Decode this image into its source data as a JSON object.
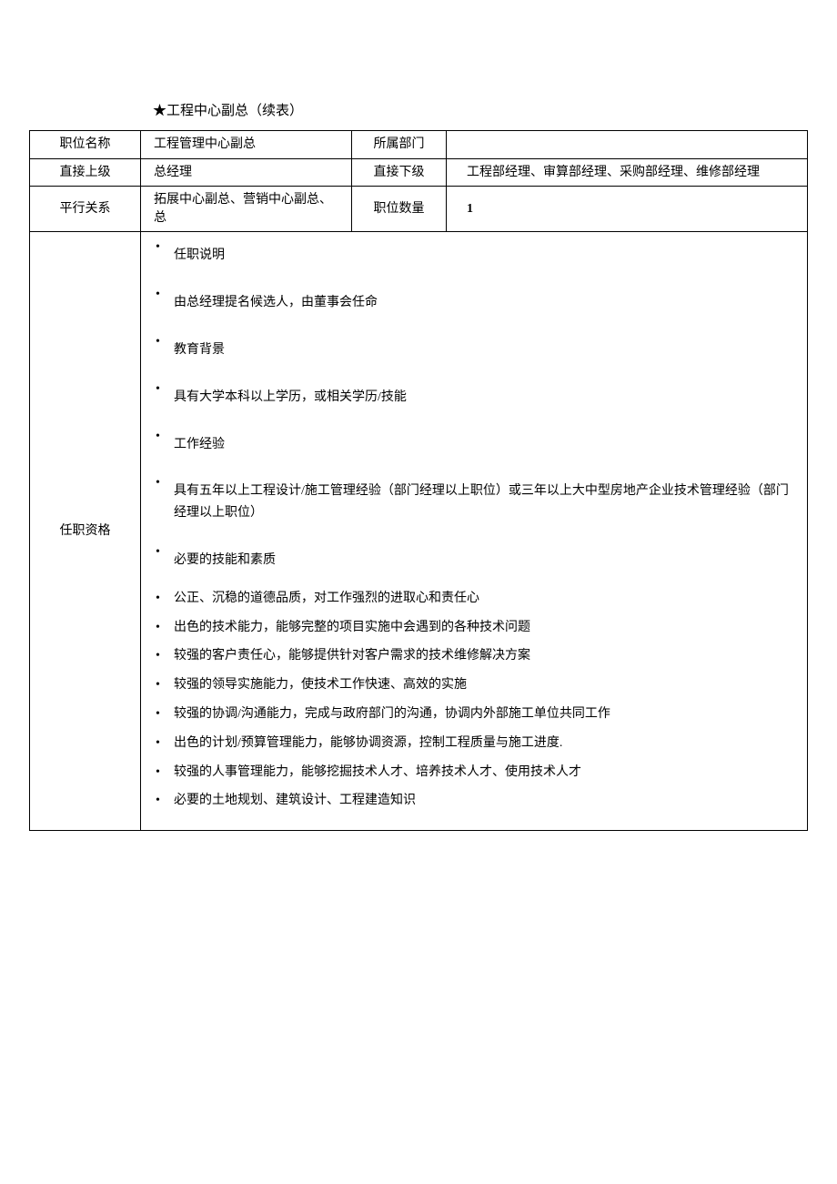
{
  "title": "★工程中心副总（续表）",
  "rows": {
    "r1": {
      "l1": "职位名称",
      "v1": "工程管理中心副总",
      "l2": "所属部门",
      "v2": ""
    },
    "r2": {
      "l1": "直接上级",
      "v1": "总经理",
      "l2": "直接下级",
      "v2": "工程部经理、审算部经理、采购部经理、维修部经理"
    },
    "r3": {
      "l1": "平行关系",
      "v1": "拓展中心副总、营销中心副总、总",
      "l2": "职位数量",
      "v2": "1"
    }
  },
  "qualification": {
    "label": "任职资格",
    "items": [
      {
        "text": "任职说明",
        "cls": "spaced"
      },
      {
        "text": "由总经理提名候选人，由董事会任命",
        "cls": "spaced"
      },
      {
        "text": "教育背景",
        "cls": "spaced"
      },
      {
        "text": "具有大学本科以上学历，或相关学历/技能",
        "cls": "spaced"
      },
      {
        "text": "工作经验",
        "cls": "spaced"
      },
      {
        "text": "具有五年以上工程设计/施工管理经验（部门经理以上职位）或三年以上大中型房地产企业技术管理经验（部门经理以上职位）",
        "cls": "spaced"
      },
      {
        "text": "必要的技能和素质",
        "cls": "spaced"
      },
      {
        "text": "公正、沉稳的道德品质，对工作强烈的进取心和责任心",
        "cls": "tight"
      },
      {
        "text": "出色的技术能力，能够完整的项目实施中会遇到的各种技术问题",
        "cls": "tight"
      },
      {
        "text": "较强的客户责任心，能够提供针对客户需求的技术维修解决方案",
        "cls": "tight"
      },
      {
        "text": "较强的领导实施能力，使技术工作快速、高效的实施",
        "cls": "tight"
      },
      {
        "text": "较强的协调/沟通能力，完成与政府部门的沟通，协调内外部施工单位共同工作",
        "cls": "tight"
      },
      {
        "text": "出色的计划/预算管理能力，能够协调资源，控制工程质量与施工进度.",
        "cls": "tight"
      },
      {
        "text": "较强的人事管理能力，能够挖掘技术人才、培养技术人才、使用技术人才",
        "cls": "tight"
      },
      {
        "text": "必要的土地规划、建筑设计、工程建造知识",
        "cls": "tight"
      }
    ]
  }
}
